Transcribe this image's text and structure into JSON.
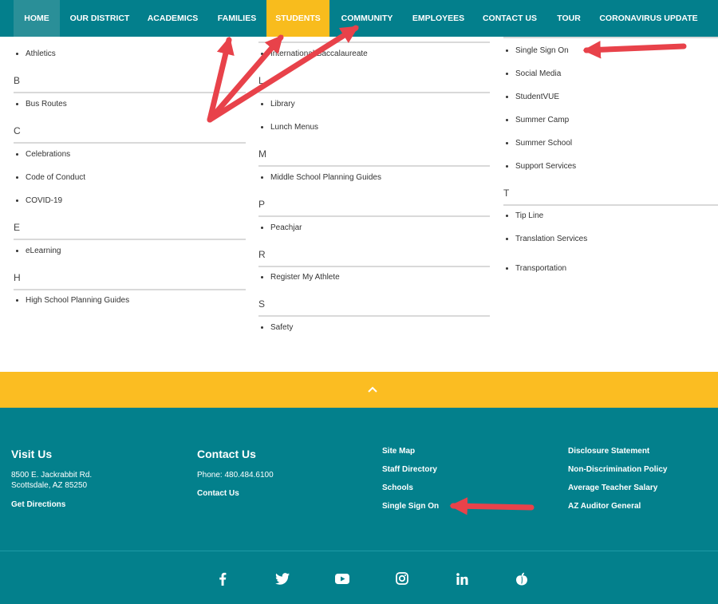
{
  "nav": {
    "items": [
      "HOME",
      "OUR DISTRICT",
      "ACADEMICS",
      "FAMILIES",
      "STUDENTS",
      "COMMUNITY",
      "EMPLOYEES",
      "CONTACT US",
      "TOUR",
      "CORONAVIRUS UPDATE"
    ]
  },
  "directory": {
    "col1": {
      "athletics": "Athletics",
      "b": "B",
      "bus_routes": "Bus Routes",
      "c": "C",
      "celebrations": "Celebrations",
      "code_of_conduct": "Code of Conduct",
      "covid": "COVID-19",
      "e": "E",
      "elearning": "eLearning",
      "h": "H",
      "hs_planning": "High School Planning Guides"
    },
    "col2": {
      "ib": "International Baccalaureate",
      "l": "L",
      "library": "Library",
      "lunch_menus": "Lunch Menus",
      "m": "M",
      "ms_planning": "Middle School Planning Guides",
      "p": "P",
      "peachjar": "Peachjar",
      "r": "R",
      "register_athlete": "Register My Athlete",
      "s": "S",
      "safety": "Safety"
    },
    "col3": {
      "sso": "Single Sign On",
      "social_media": "Social Media",
      "studentvue": "StudentVUE",
      "summer_camp": "Summer Camp",
      "summer_school": "Summer School",
      "support_services": "Support Services",
      "t": "T",
      "tip_line": "Tip Line",
      "translation": "Translation Services",
      "transportation": "Transportation"
    }
  },
  "footer": {
    "visit": {
      "heading": "Visit Us",
      "address1": "8500 E. Jackrabbit Rd.",
      "address2": "Scottsdale, AZ 85250",
      "directions": "Get Directions"
    },
    "contact": {
      "heading": "Contact Us",
      "phone": "Phone: 480.484.6100",
      "link": "Contact Us"
    },
    "links1": [
      "Site Map",
      "Staff Directory",
      "Schools",
      "Single Sign On"
    ],
    "links2": [
      "Disclosure Statement",
      "Non-Discrimination Policy",
      "Average Teacher Salary",
      "AZ Auditor General"
    ],
    "social": [
      "facebook-icon",
      "twitter-icon",
      "youtube-icon",
      "instagram-icon",
      "linkedin-icon",
      "peachjar-icon"
    ]
  },
  "colors": {
    "nav_bg": "#037f8c",
    "students_tab": "#f8bc1d",
    "yellow_bar": "#fbbd22",
    "footer_bg": "#03808c",
    "annotation_arrow": "#e8424a"
  }
}
